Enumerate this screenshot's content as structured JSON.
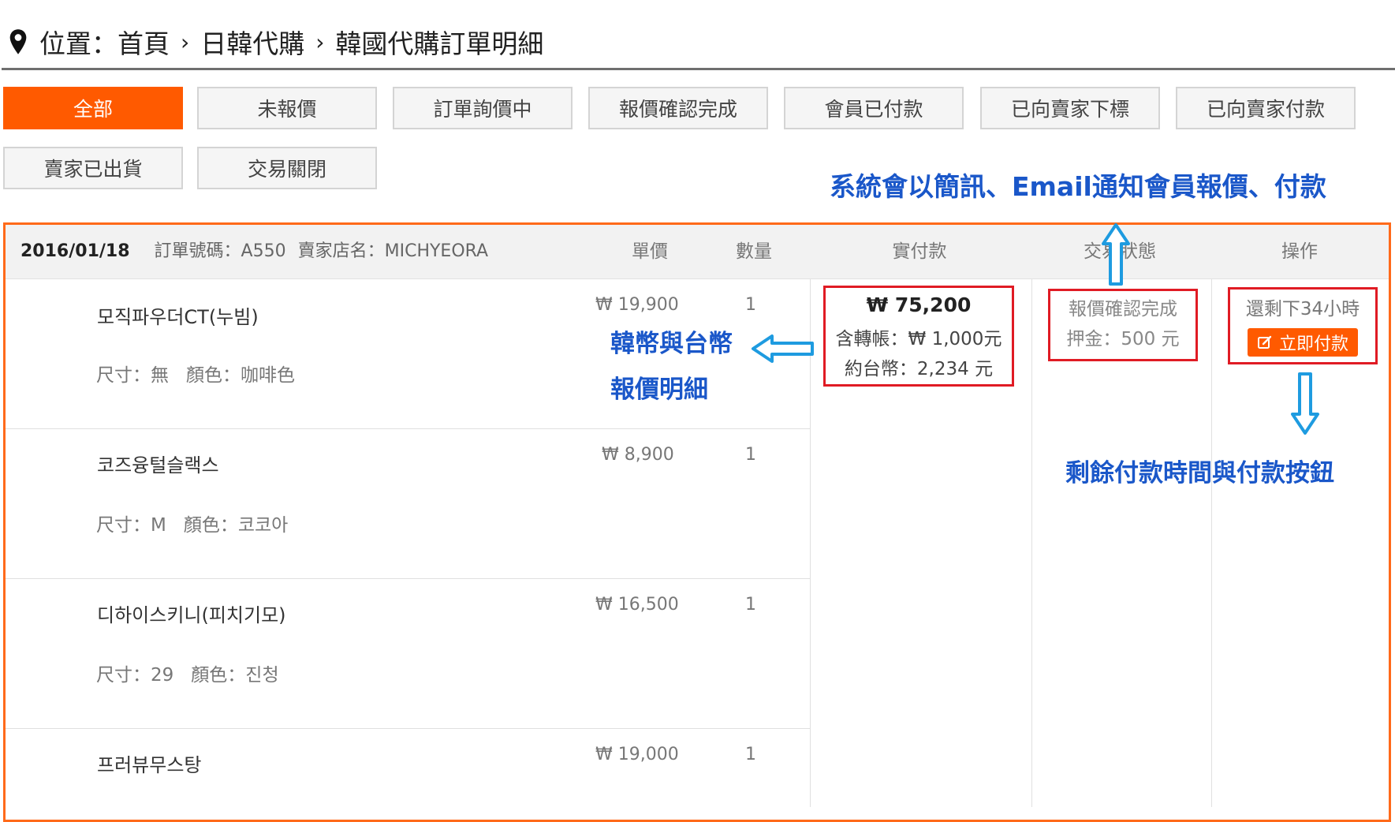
{
  "breadcrumb": {
    "prefix": "位置：首頁",
    "sep": "›",
    "level2": "日韓代購",
    "level3": "韓國代購訂單明細"
  },
  "filters": [
    "全部",
    "未報價",
    "訂單詢價中",
    "報價確認完成",
    "會員已付款",
    "已向賣家下標",
    "已向賣家付款",
    "賣家已出貨",
    "交易關閉"
  ],
  "annotations": {
    "notify": "系統會以簡訊、Email通知會員報價、付款",
    "currency_line1": "韓幣與台幣",
    "currency_line2": "報價明細",
    "remaining": "剩餘付款時間與付款按鈕"
  },
  "order": {
    "date": "2016/01/18",
    "number_label": "訂單號碼：",
    "number": "A550",
    "shop_label": "賣家店名：",
    "shop": "MICHYEORA",
    "columns": {
      "unit_price": "單價",
      "qty": "數量",
      "paid": "實付款",
      "status": "交易狀態",
      "action": "操作"
    },
    "payment": {
      "total": "₩ 75,200",
      "transfer_label": "含轉帳：",
      "transfer": "₩ 1,000元",
      "twd_label": "約台幣：",
      "twd": "2,234 元"
    },
    "status": {
      "text": "報價確認完成",
      "deposit": "押金：500 元"
    },
    "action": {
      "remaining": "還剩下34小時",
      "pay_button": "立即付款"
    },
    "items": [
      {
        "name": "모직파우더CT(누빔)",
        "size": "尺寸：無",
        "color": "顏色：咖啡色",
        "price": "₩ 19,900",
        "qty": "1"
      },
      {
        "name": "코즈융털슬랙스",
        "size": "尺寸：M",
        "color": "顏色：코코아",
        "price": "₩ 8,900",
        "qty": "1"
      },
      {
        "name": "디하이스키니(피치기모)",
        "size": "尺寸：29",
        "color": "顏色：진청",
        "price": "₩ 16,500",
        "qty": "1"
      },
      {
        "name": "프러뷰무스탕",
        "price": "₩ 19,000",
        "qty": "1"
      }
    ]
  },
  "colors": {
    "accent": "#ff5a00",
    "annotation": "#1a57c9",
    "highlight_box": "#e01b24",
    "arrow": "#1e9be0"
  }
}
